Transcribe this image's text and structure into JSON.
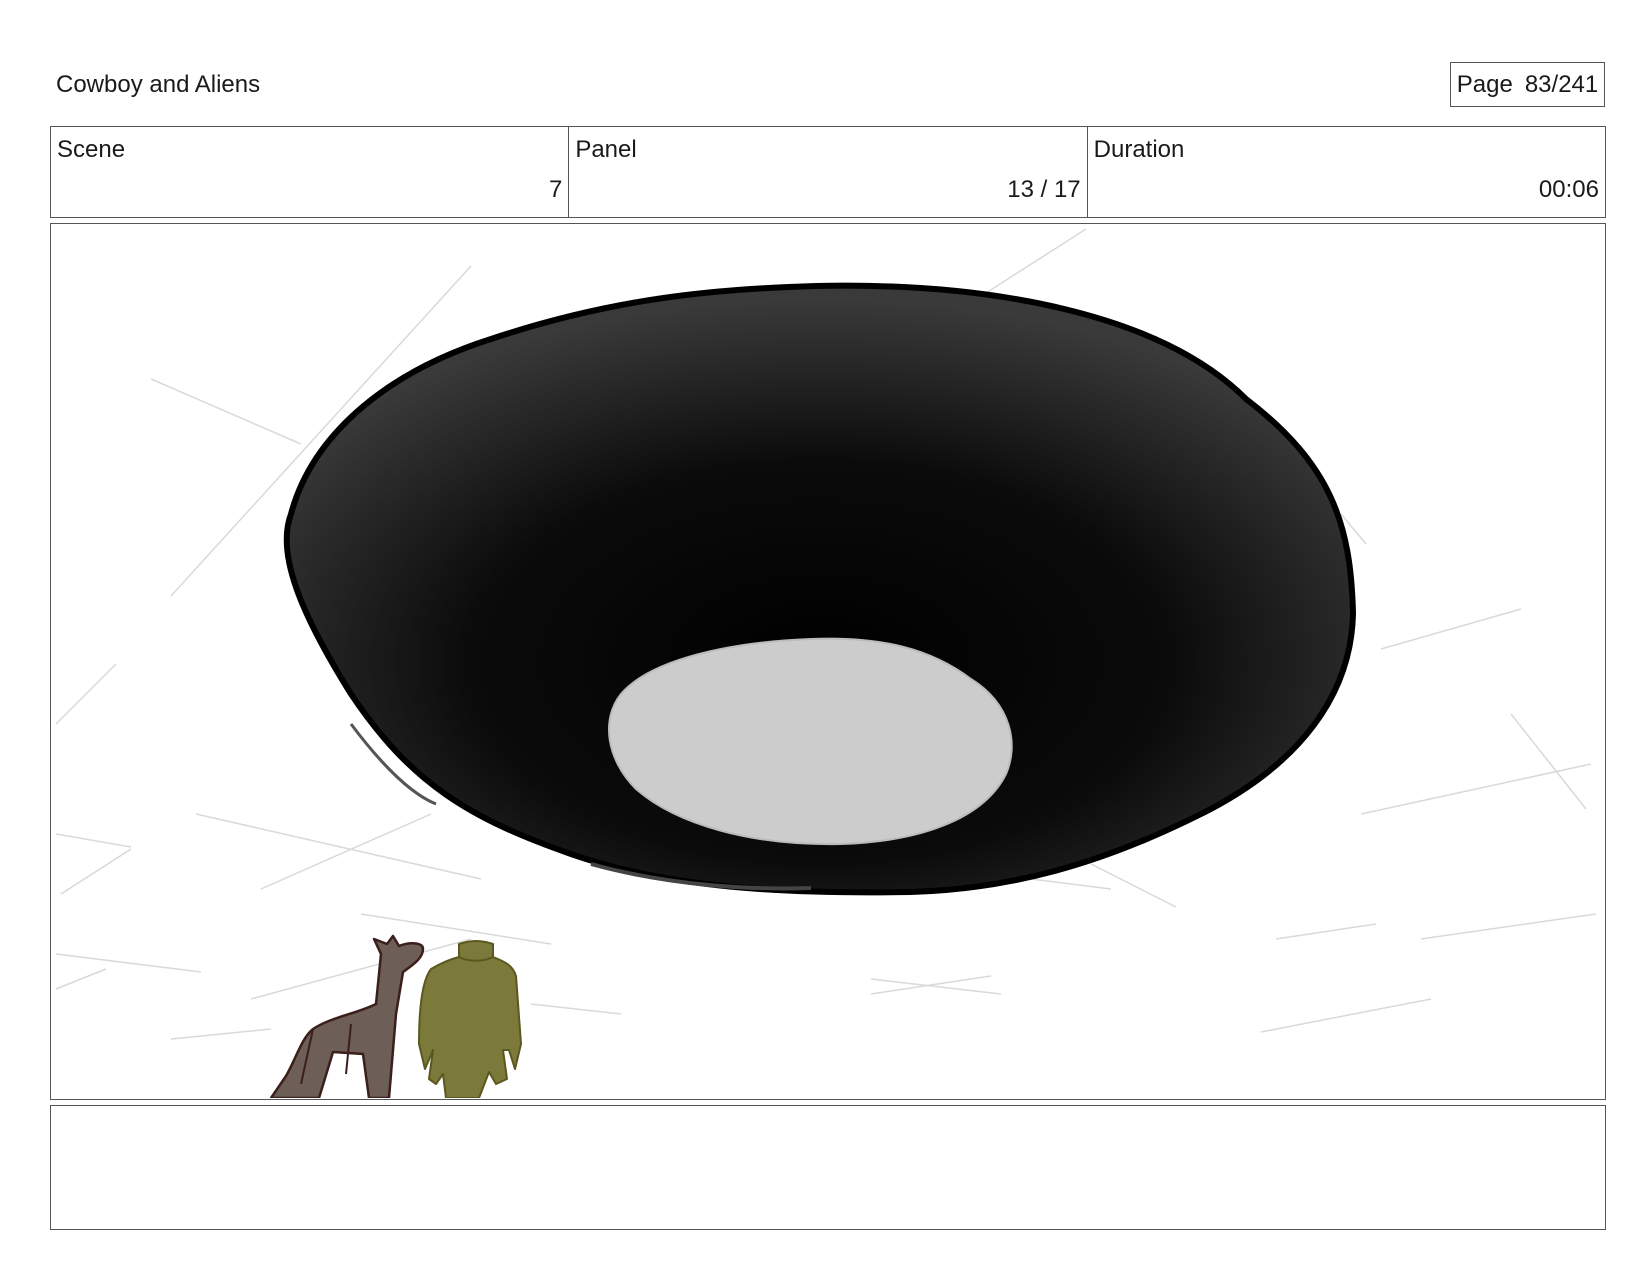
{
  "header": {
    "project_title": "Cowboy and Aliens",
    "page_label": "Page",
    "page_value": "83/241"
  },
  "info": {
    "scene_label": "Scene",
    "scene_value": "7",
    "panel_label": "Panel",
    "panel_value": "13 / 17",
    "duration_label": "Duration",
    "duration_value": "00:06"
  },
  "panel": {
    "subjects": [
      "ufo-saucer",
      "horse",
      "cowboy"
    ],
    "colors": {
      "saucer": "#0a0a0a",
      "saucer_light": "#cccccc",
      "horse": "#6e5e58",
      "cowboy": "#7b7a3a",
      "sketch_lines": "#d9d9d9"
    }
  },
  "notes": {
    "text": ""
  }
}
